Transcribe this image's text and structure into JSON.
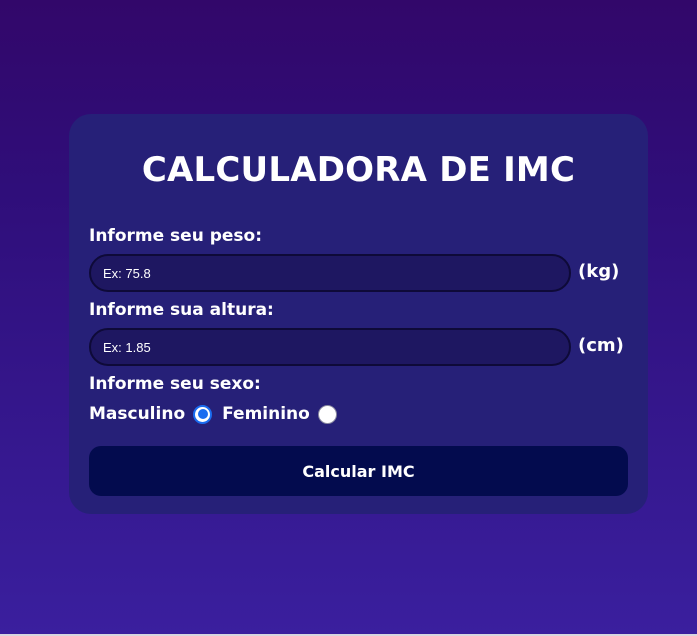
{
  "card": {
    "title": "CALCULADORA DE IMC"
  },
  "weight": {
    "label": "Informe seu peso:",
    "placeholder": "Ex: 75.8",
    "value": "",
    "unit": "(kg)"
  },
  "height": {
    "label": "Informe sua altura:",
    "placeholder": "Ex: 1.85",
    "value": "",
    "unit": "(cm)"
  },
  "sex": {
    "label": "Informe seu sexo:",
    "options": [
      {
        "label": "Masculino",
        "checked": true
      },
      {
        "label": "Feminino",
        "checked": false
      }
    ]
  },
  "submit": {
    "label": "Calcular IMC"
  },
  "colors": {
    "background_top": "#32076a",
    "background_bottom": "#3a1f9e",
    "card": "#262078",
    "input_bg": "#1e1761",
    "button_bg": "#030b4e",
    "radio_accent": "#1a6cf0",
    "text": "#ffffff"
  }
}
